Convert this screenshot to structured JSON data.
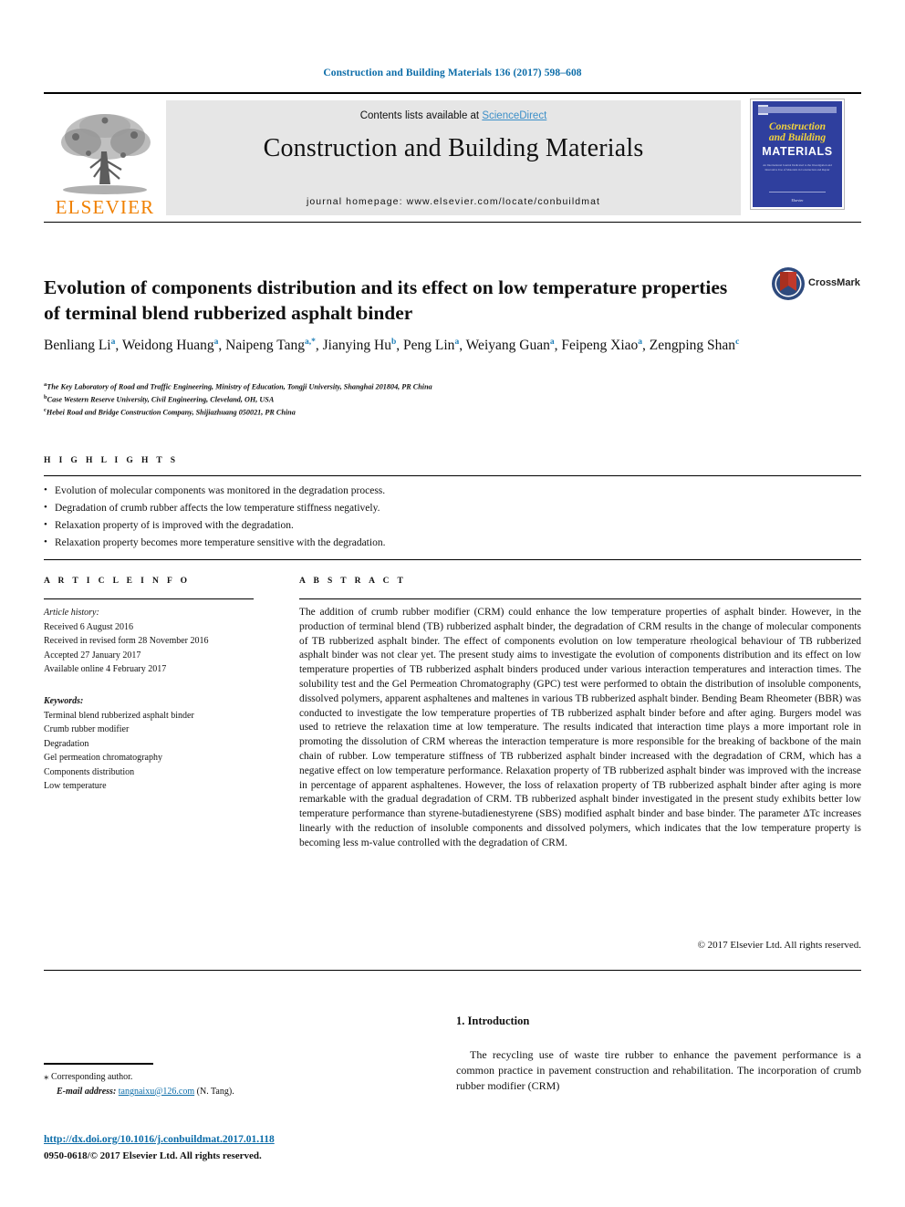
{
  "journal_ref": "Construction and Building Materials 136 (2017) 598–608",
  "masthead": {
    "contents_prefix": "Contents lists available at ",
    "sciencedirect": "ScienceDirect",
    "journal_title": "Construction and Building Materials",
    "homepage": "journal homepage: www.elsevier.com/locate/conbuildmat",
    "publisher_wordmark": "ELSEVIER",
    "publisher_color": "#F08000",
    "sciencedirect_color": "#3c8fc8"
  },
  "cover": {
    "line1": "Construction",
    "line2": "and Building",
    "line3": "MATERIALS",
    "blurb": "An International Journal Dedicated to the Investigation and Innovative Use of Materials in Construction and Repair",
    "footer": "Elsevier",
    "bg_color": "#2f3f9e",
    "title_color": "#f2d33c"
  },
  "article": {
    "title": "Evolution of components distribution and its effect on low temperature properties of terminal blend rubberized asphalt binder",
    "crossmark_label": "CrossMark",
    "authors": [
      {
        "name": "Benliang Li",
        "sup": "a"
      },
      {
        "name": "Weidong Huang",
        "sup": "a"
      },
      {
        "name": "Naipeng Tang",
        "sup": "a,*"
      },
      {
        "name": "Jianying Hu",
        "sup": "b"
      },
      {
        "name": "Peng Lin",
        "sup": "a"
      },
      {
        "name": "Weiyang Guan",
        "sup": "a"
      },
      {
        "name": "Feipeng Xiao",
        "sup": "a"
      },
      {
        "name": "Zengping Shan",
        "sup": "c"
      }
    ],
    "affiliations": [
      {
        "sup": "a",
        "text": "The Key Laboratory of Road and Traffic Engineering, Ministry of Education, Tongji University, Shanghai 201804, PR China"
      },
      {
        "sup": "b",
        "text": "Case Western Reserve University, Civil Engineering, Cleveland, OH, USA"
      },
      {
        "sup": "c",
        "text": "Hebei Road and Bridge Construction Company, Shijiazhuang 050021, PR China"
      }
    ]
  },
  "highlights": {
    "heading": "H I G H L I G H T S",
    "items": [
      "Evolution of molecular components was monitored in the degradation process.",
      "Degradation of crumb rubber affects the low temperature stiffness negatively.",
      "Relaxation property of is improved with the degradation.",
      "Relaxation property becomes more temperature sensitive with the degradation."
    ]
  },
  "article_info": {
    "heading": "A R T I C L E   I N F O",
    "history_label": "Article history:",
    "history": [
      "Received 6 August 2016",
      "Received in revised form 28 November 2016",
      "Accepted 27 January 2017",
      "Available online 4 February 2017"
    ],
    "keywords_label": "Keywords:",
    "keywords": [
      "Terminal blend rubberized asphalt binder",
      "Crumb rubber modifier",
      "Degradation",
      "Gel permeation chromatography",
      "Components distribution",
      "Low temperature"
    ]
  },
  "abstract": {
    "heading": "A B S T R A C T",
    "text": "The addition of crumb rubber modifier (CRM) could enhance the low temperature properties of asphalt binder. However, in the production of terminal blend (TB) rubberized asphalt binder, the degradation of CRM results in the change of molecular components of TB rubberized asphalt binder. The effect of components evolution on low temperature rheological behaviour of TB rubberized asphalt binder was not clear yet. The present study aims to investigate the evolution of components distribution and its effect on low temperature properties of TB rubberized asphalt binders produced under various interaction temperatures and interaction times. The solubility test and the Gel Permeation Chromatography (GPC) test were performed to obtain the distribution of insoluble components, dissolved polymers, apparent asphaltenes and maltenes in various TB rubberized asphalt binder. Bending Beam Rheometer (BBR) was conducted to investigate the low temperature properties of TB rubberized asphalt binder before and after aging. Burgers model was used to retrieve the relaxation time at low temperature. The results indicated that interaction time plays a more important role in promoting the dissolution of CRM whereas the interaction temperature is more responsible for the breaking of backbone of the main chain of rubber. Low temperature stiffness of TB rubberized asphalt binder increased with the degradation of CRM, which has a negative effect on low temperature performance. Relaxation property of TB rubberized asphalt binder was improved with the increase in percentage of apparent asphaltenes. However, the loss of relaxation property of TB rubberized asphalt binder after aging is more remarkable with the gradual degradation of CRM. TB rubberized asphalt binder investigated in the present study exhibits better low temperature performance than styrene-butadienestyrene (SBS) modified asphalt binder and base binder. The parameter ΔTc increases linearly with the reduction of insoluble components and dissolved polymers, which indicates that the low temperature property is becoming less m-value controlled with the degradation of CRM.",
    "copyright": "© 2017 Elsevier Ltd. All rights reserved."
  },
  "introduction": {
    "heading": "1. Introduction",
    "paragraph": "The recycling use of waste tire rubber to enhance the pavement performance is a common practice in pavement construction and rehabilitation. The incorporation of crumb rubber modifier (CRM)"
  },
  "footer": {
    "corresponding_star": "⁎",
    "corresponding_label": "Corresponding author.",
    "email_label": "E-mail address:",
    "email": "tangnaixu@126.com",
    "email_attrib": "(N. Tang).",
    "doi": "http://dx.doi.org/10.1016/j.conbuildmat.2017.01.118",
    "issn": "0950-0618/© 2017 Elsevier Ltd. All rights reserved.",
    "link_color": "#0b6ca8"
  }
}
